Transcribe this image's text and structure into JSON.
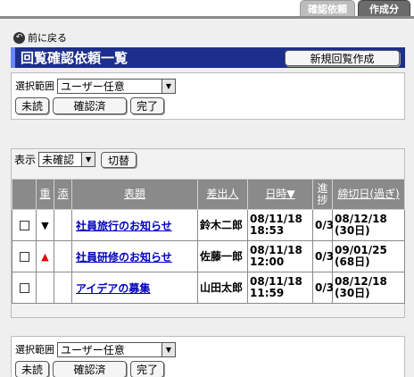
{
  "tabs": [
    {
      "label": "確認依頼",
      "active": false
    },
    {
      "label": "作成分",
      "active": true
    }
  ],
  "back_label": "前に戻る",
  "title": "回覧確認依頼一覧",
  "new_button": "新規回覧作成",
  "filter": {
    "label": "選択範囲",
    "value": "ユーザー任意",
    "buttons": [
      "未読",
      "確認済",
      "完了"
    ]
  },
  "list": {
    "display_label": "表示",
    "display_value": "未確認",
    "switch_label": "切替",
    "columns": [
      "重",
      "添",
      "表題",
      "差出人",
      "日時▼",
      "進捗",
      "締切日(過ぎ)"
    ],
    "rows": [
      {
        "priority": "down",
        "subject": "社員旅行のお知らせ",
        "sender": "鈴木二郎",
        "datetime": "08/11/18 18:53",
        "progress": "0/3",
        "deadline": "08/12/18 (30日)"
      },
      {
        "priority": "up",
        "subject": "社員研修のお知らせ",
        "sender": "佐藤一郎",
        "datetime": "08/11/18 12:00",
        "progress": "0/3",
        "deadline": "09/01/25 (68日)"
      },
      {
        "priority": "none",
        "subject": "アイデアの募集",
        "sender": "山田太郎",
        "datetime": "08/11/18 11:59",
        "progress": "0/3",
        "deadline": "08/12/18 (30日)"
      }
    ]
  },
  "colors": {
    "title_bg": "#1d2f8c",
    "header_bg": "#8a8a8a",
    "link": "#0000c0",
    "down": "#000000",
    "up": "#e00000"
  }
}
